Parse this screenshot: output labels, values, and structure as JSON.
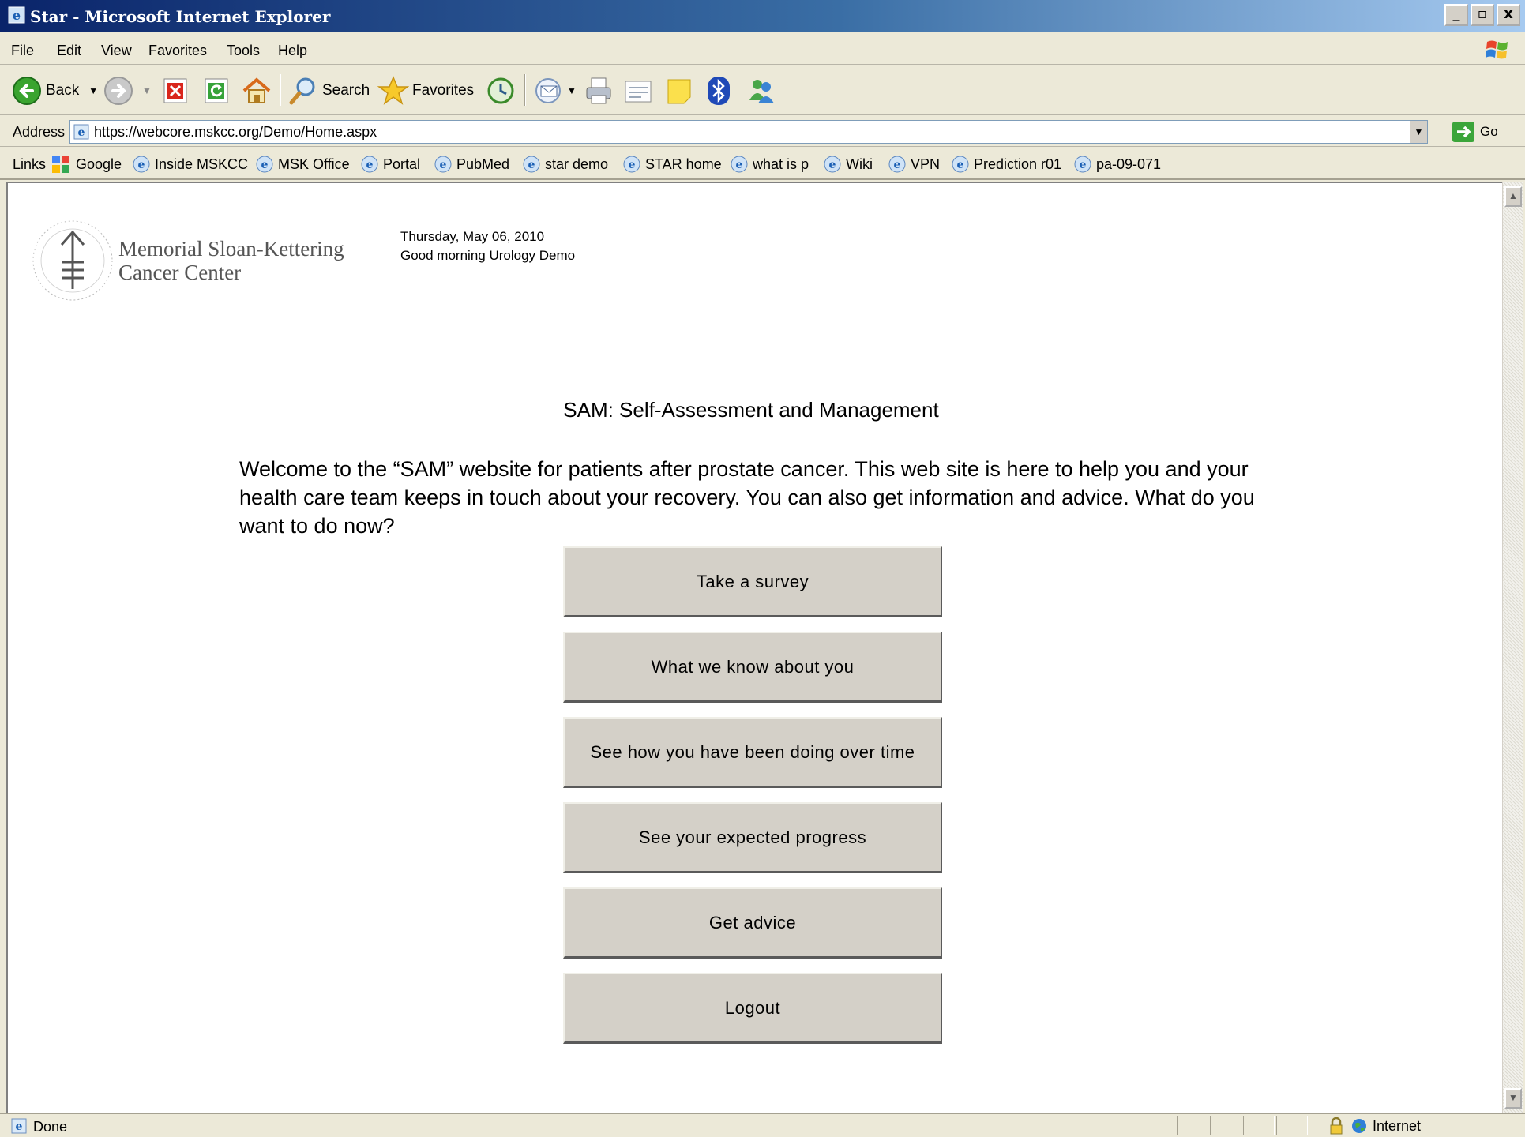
{
  "window": {
    "title": "Star - Microsoft Internet Explorer",
    "buttons": [
      "_",
      "▫",
      "x"
    ]
  },
  "menu": [
    "File",
    "Edit",
    "View",
    "Favorites",
    "Tools",
    "Help"
  ],
  "toolbar": {
    "back": "Back",
    "search": "Search",
    "favorites": "Favorites"
  },
  "address": {
    "label": "Address",
    "url": "https://webcore.mskcc.org/Demo/Home.aspx",
    "go": "Go"
  },
  "links": {
    "label": "Links",
    "items": [
      "Google",
      "Inside MSKCC",
      "MSK Office",
      "Portal",
      "PubMed",
      "star demo",
      "STAR home",
      "what is p",
      "Wiki",
      "VPN",
      "Prediction r01",
      "pa-09-071"
    ]
  },
  "page": {
    "logo_line1": "Memorial Sloan-Kettering",
    "logo_line2": "Cancer Center",
    "date": "Thursday, May 06, 2010",
    "greeting": "Good morning Urology Demo",
    "title": "SAM: Self-Assessment and Management",
    "welcome": "Welcome to the “SAM” website for patients after prostate cancer. This web site is here to help you and your health care team keeps in touch about your recovery. You can also get information and advice. What do you want to do now?",
    "buttons": [
      "Take a survey",
      "What we know about you",
      "See how you have been doing over time",
      "See your expected progress",
      "Get advice",
      "Logout"
    ]
  },
  "status": {
    "text": "Done",
    "zone": "Internet"
  },
  "colors": {
    "titlebar": "#0a246a",
    "chrome": "#ece9d8",
    "button": "#d4d0c8"
  }
}
